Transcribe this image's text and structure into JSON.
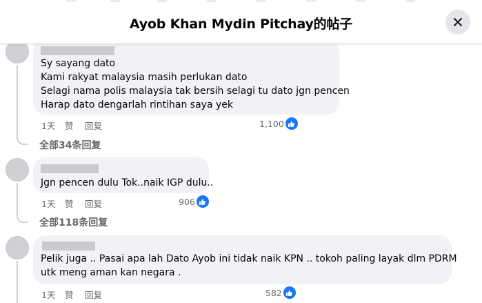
{
  "dialog": {
    "title": "Ayob Khan Mydin Pitchay的帖子",
    "close_icon": "close-icon"
  },
  "comments": [
    {
      "lines": [
        "Sy sayang dato",
        "Kami rakyat malaysia masih perlukan dato",
        "Selagi nama polis malaysia tak bersih selagi tu dato jgn pencen",
        "Harap dato dengarlah rintihan saya yek"
      ],
      "time": "1天",
      "like_label": "赞",
      "reply_label": "回复",
      "reaction_count": "1,100",
      "view_replies": "全部34条回复"
    },
    {
      "lines": [
        "Jgn pencen dulu Tok..naik IGP dulu.."
      ],
      "time": "1天",
      "like_label": "赞",
      "reply_label": "回复",
      "reaction_count": "906",
      "view_replies": "全部118条回复"
    },
    {
      "lines": [
        "Pelik juga .. Pasai apa lah Dato Ayob ini tidak naik KPN .. tokoh paling layak dlm PDRM",
        "utk meng aman kan negara ."
      ],
      "time": "1天",
      "like_label": "赞",
      "reply_label": "回复",
      "reaction_count": "582"
    }
  ],
  "colors": {
    "bubble": "#f0f2f5",
    "secondary_text": "#65676b",
    "like_blue": "#1877f2"
  }
}
